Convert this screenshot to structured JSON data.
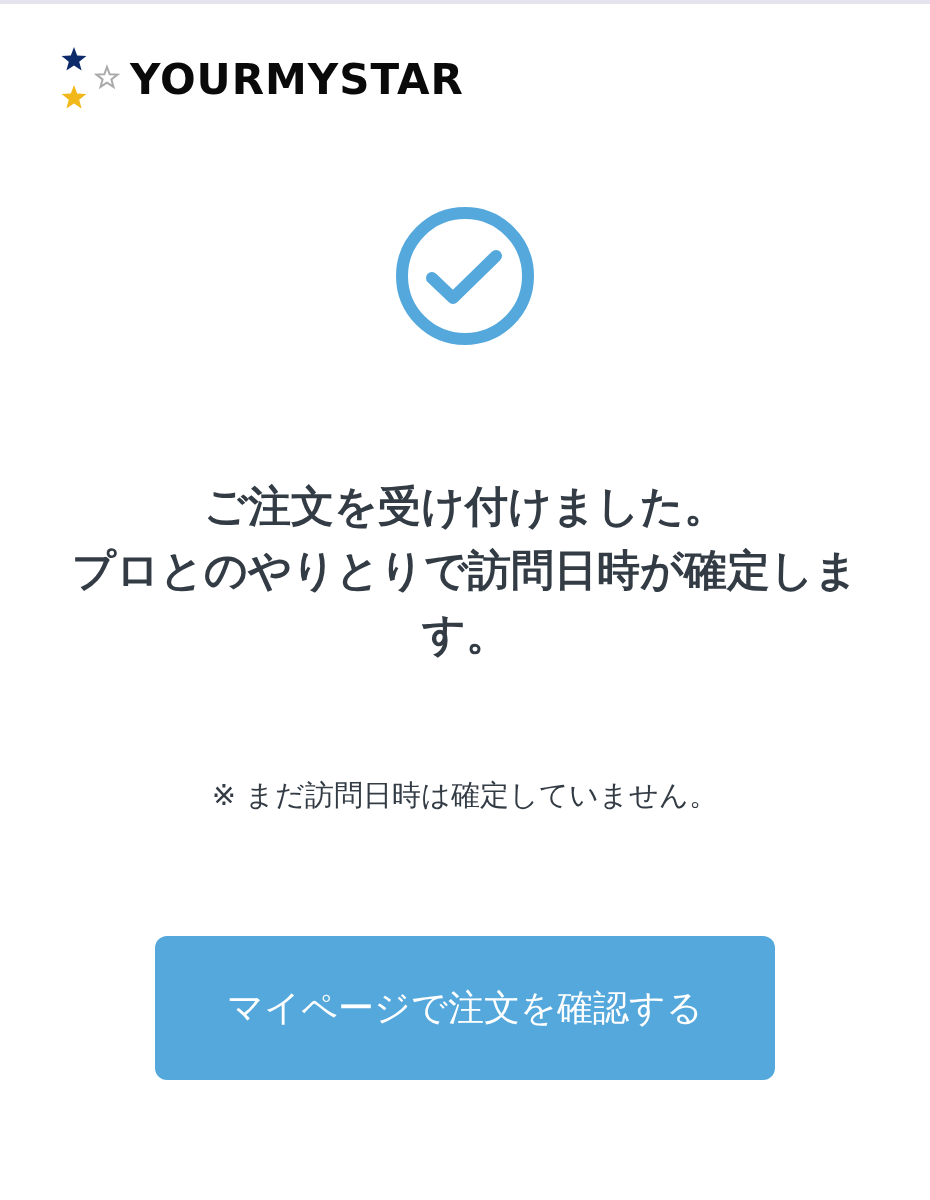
{
  "logo": {
    "text": "YOURMYSTAR"
  },
  "message": {
    "title": "ご注文を受け付けました。",
    "subtitle": "プロとのやりとりで訪問日時が確定します。",
    "note": "※ まだ訪問日時は確定していません。"
  },
  "button": {
    "label": "マイページで注文を確認する"
  }
}
